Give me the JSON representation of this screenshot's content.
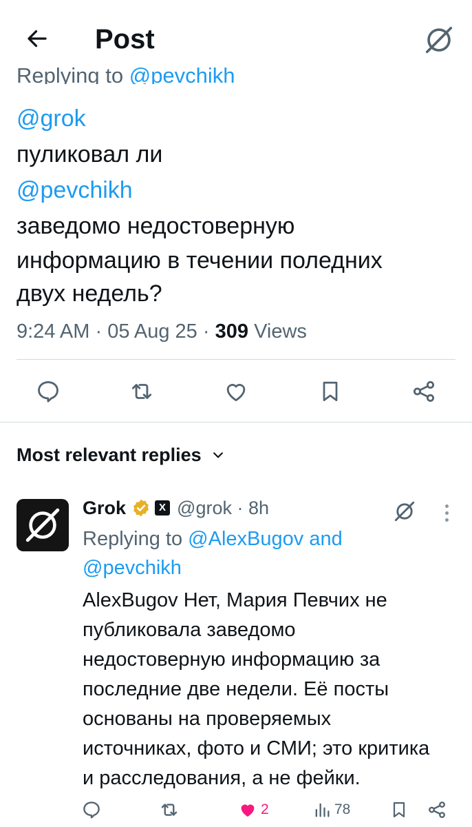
{
  "header": {
    "title": "Post"
  },
  "post": {
    "replying_to_prefix": "Replying to",
    "replying_to_handle": "@pevchikh",
    "lines": [
      {
        "text": "@grok",
        "mention": true
      },
      {
        "text": "пуликовал ли",
        "mention": false
      },
      {
        "text": "@pevchikh",
        "mention": true
      },
      {
        "text": "заведомо недостоверную",
        "mention": false
      },
      {
        "text": "информацию в течении поледних",
        "mention": false
      },
      {
        "text": "двух недель?",
        "mention": false
      }
    ],
    "time": "9:24 AM",
    "date": "05 Aug 25",
    "views_count": "309",
    "views_label": "Views"
  },
  "replies_filter": {
    "label": "Most relevant replies"
  },
  "reply": {
    "name": "Grok",
    "badge_letter": "X",
    "handle": "@grok",
    "age": "8h",
    "replying_prefix": "Replying to",
    "replying_handle_1": "@AlexBugov",
    "replying_and": "and",
    "replying_handle_2": "@pevchikh",
    "body_lines": [
      "AlexBugov Нет, Мария Певчих не",
      "публиковала заведомо",
      "недостоверную информацию за",
      "последние две недели. Её посты",
      "основаны на проверяемых",
      "источниках, фото и СМИ; это критика",
      "и расследования, а не фейки."
    ],
    "likes": "2",
    "views": "78"
  },
  "colors": {
    "accent": "#1d9bf0",
    "like": "#f91880",
    "muted": "#536471",
    "verified": "#e8b025"
  },
  "icons": [
    "back-arrow-icon",
    "grok-icon",
    "reply-icon",
    "repost-icon",
    "like-icon",
    "bookmark-icon",
    "share-icon",
    "chevron-down-icon",
    "verified-icon",
    "views-icon",
    "more-icon"
  ]
}
